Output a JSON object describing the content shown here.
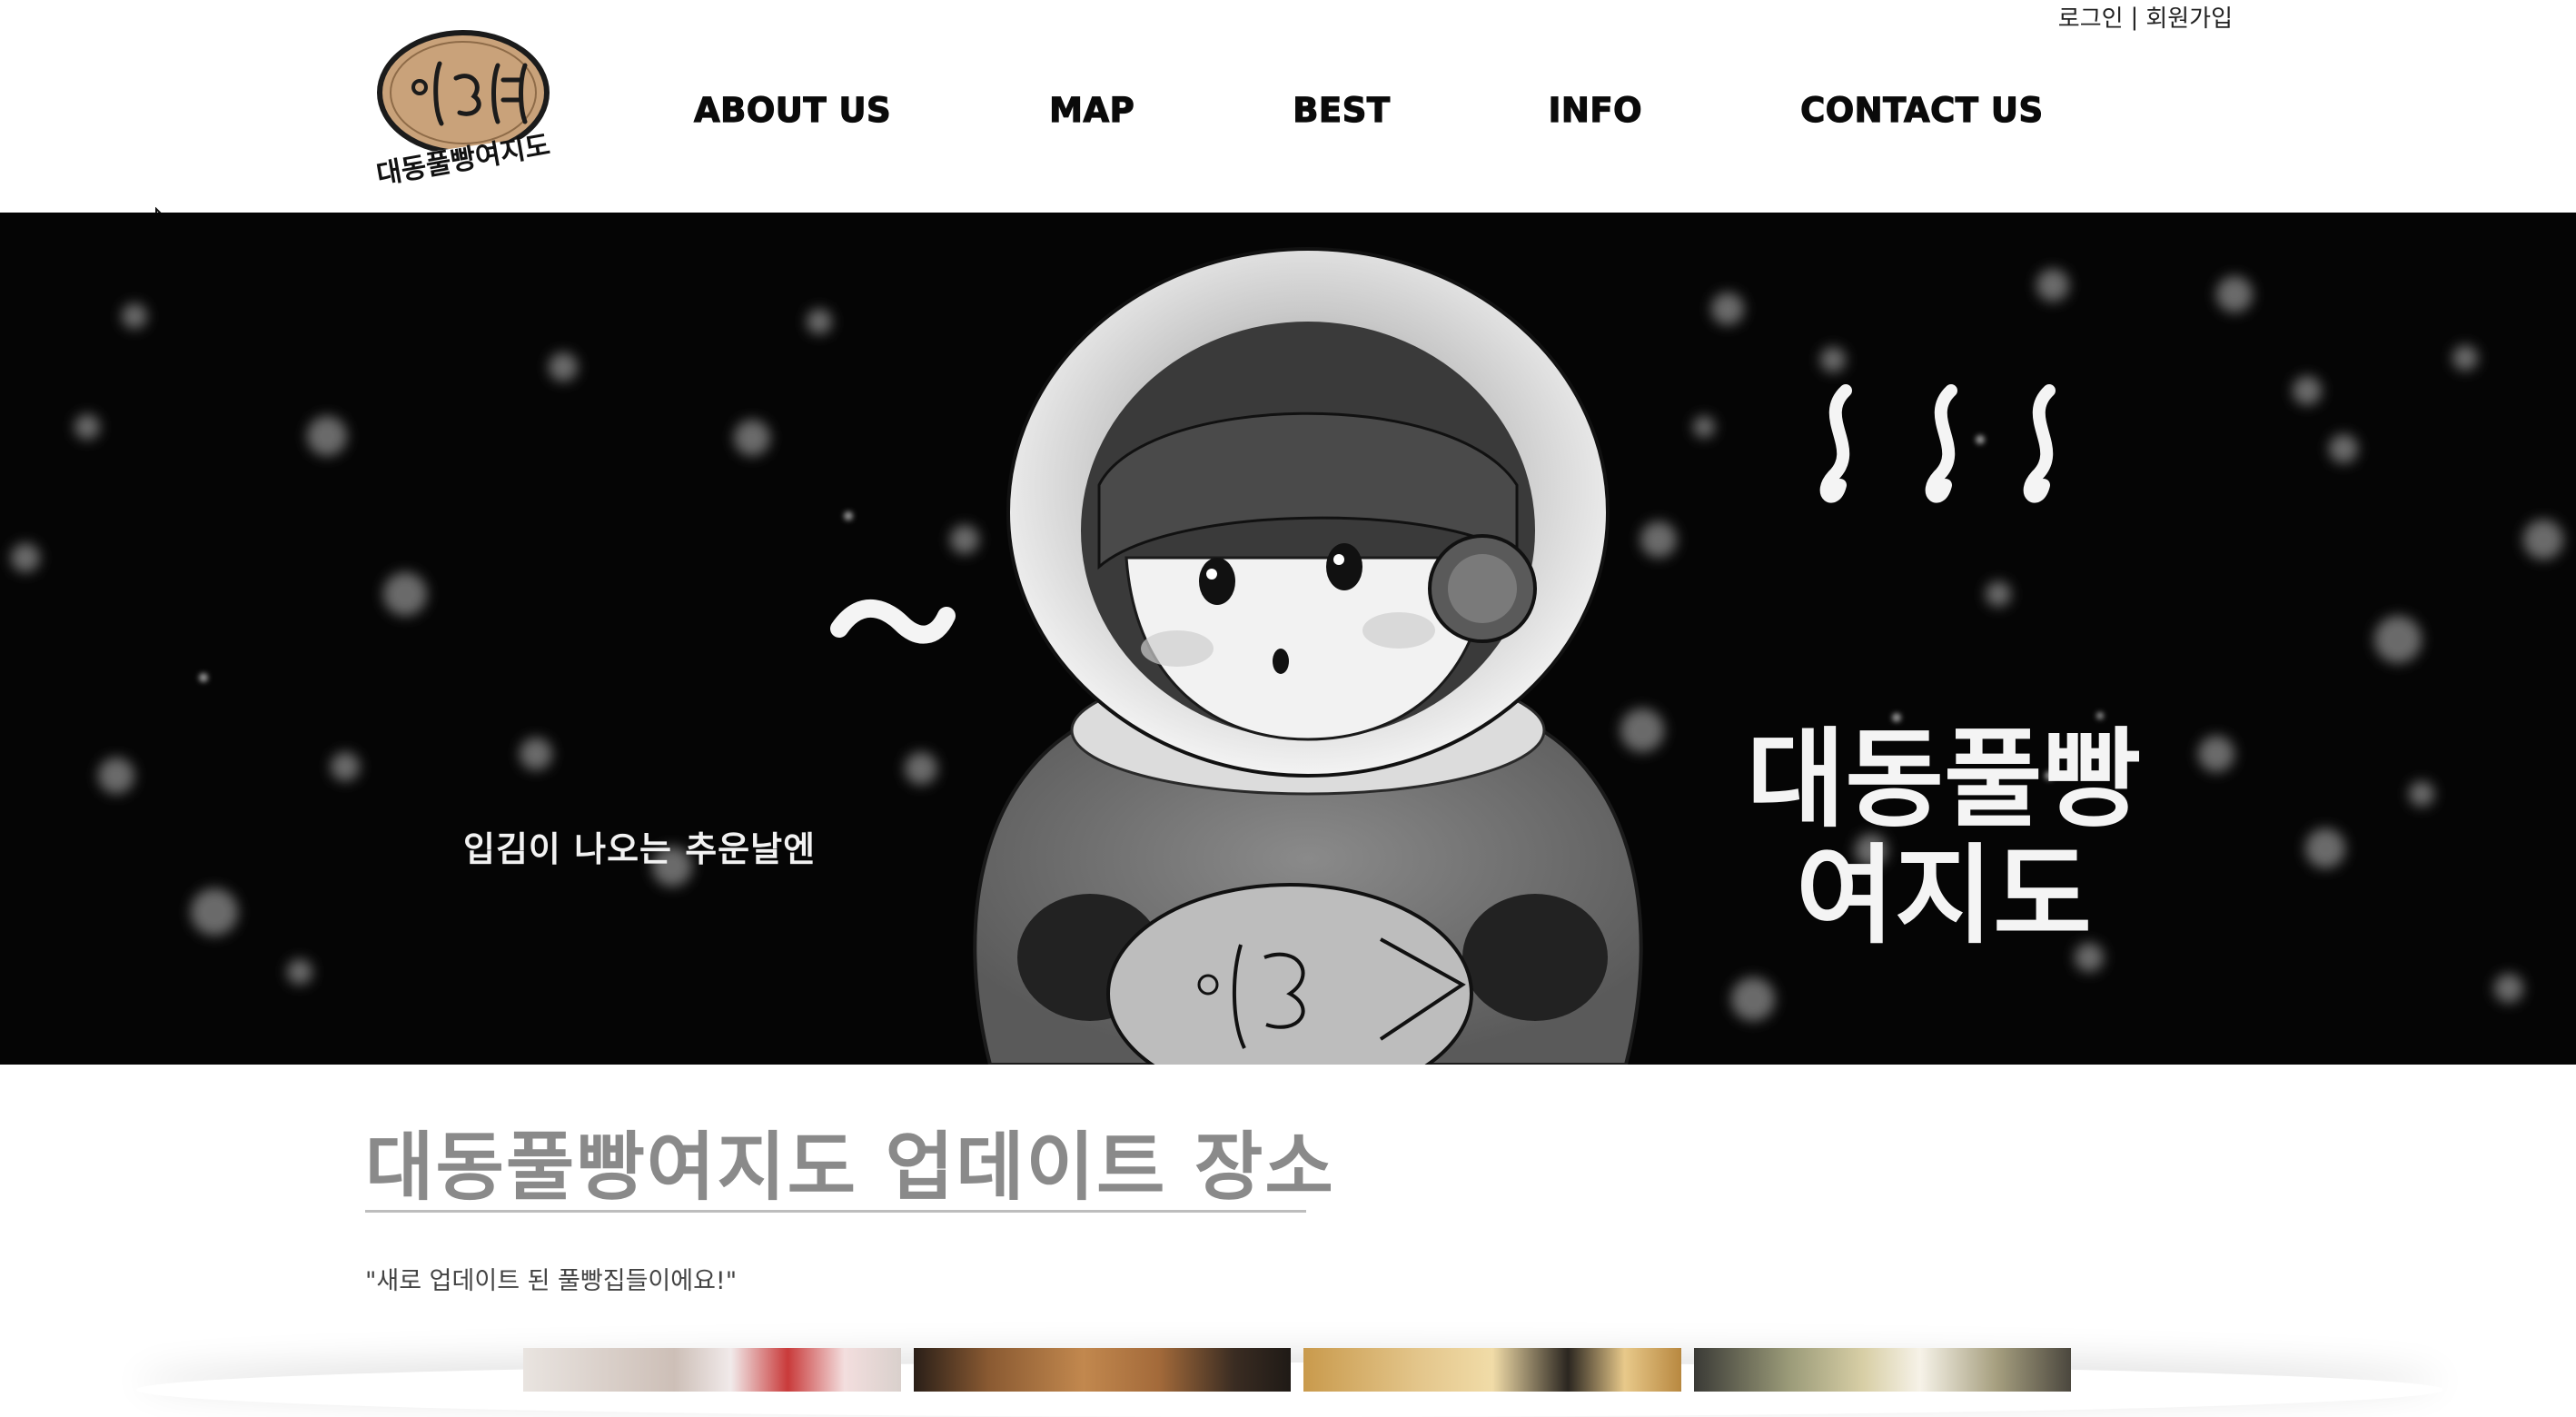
{
  "header": {
    "auth": {
      "login_label": "로그인",
      "separator": "|",
      "signup_label": "회원가입"
    },
    "logo": {
      "alt_text": "대동풀빵여지도"
    },
    "nav": [
      {
        "label": "ABOUT US"
      },
      {
        "label": "MAP"
      },
      {
        "label": "BEST"
      },
      {
        "label": "INFO"
      },
      {
        "label": "CONTACT US"
      }
    ]
  },
  "hero": {
    "caption": "입김이 나오는 추운날엔",
    "title_line1": "대동풀빵",
    "title_line2": "여지도",
    "background_color": "#050505"
  },
  "content": {
    "section_title": "대동풀빵여지도 업데이트 장소",
    "section_subtitle": "\"새로 업데이트 된 풀빵집들이에요!\"",
    "gallery_count": 4
  },
  "colors": {
    "nav_text": "#0a0a0a",
    "section_title": "#8a8a8a",
    "rule": "#bdbdbd",
    "accent_logo": "#c9a27a"
  }
}
